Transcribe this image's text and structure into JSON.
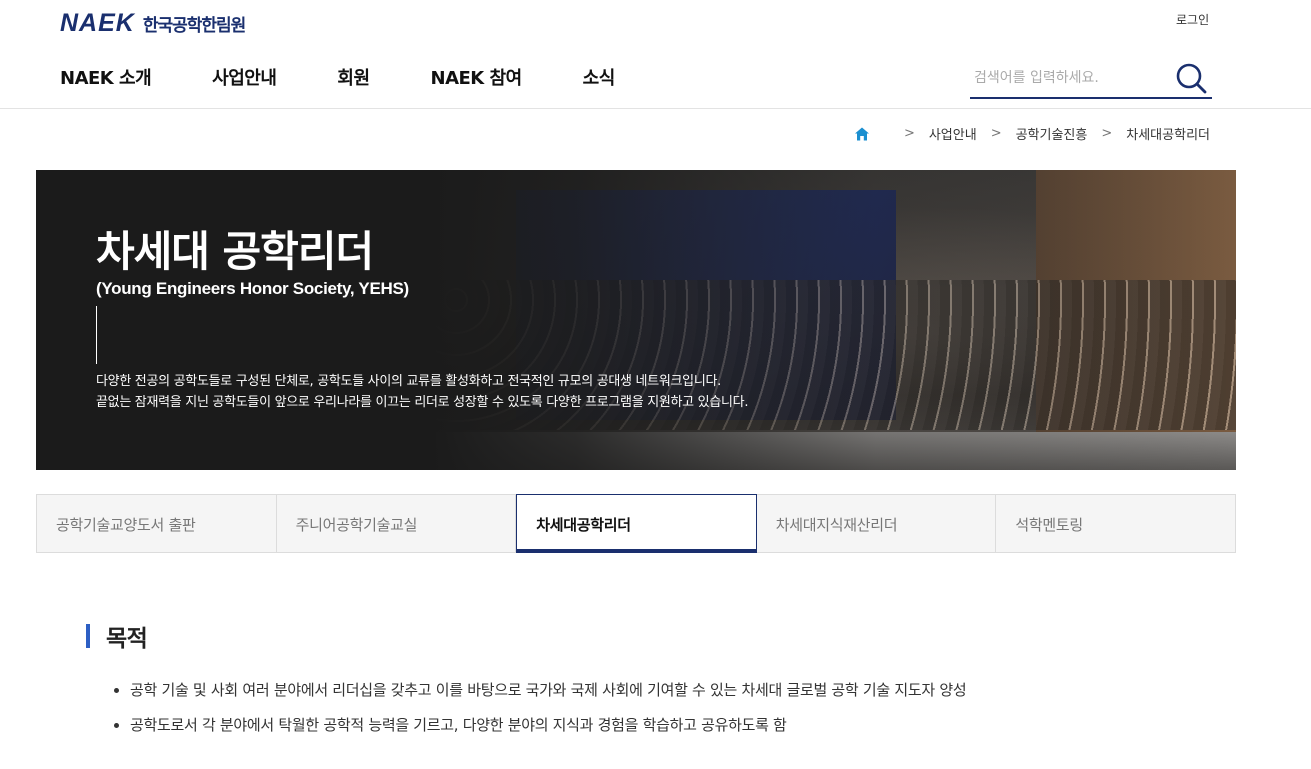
{
  "header": {
    "logo_mark": "NAEK",
    "logo_name": "한국공학한림원",
    "login": "로그인",
    "nav": [
      "NAEK 소개",
      "사업안내",
      "회원",
      "NAEK 참여",
      "소식"
    ],
    "search_placeholder": "검색어를 입력하세요."
  },
  "breadcrumb": {
    "items": [
      "사업안내",
      "공학기술진흥",
      "차세대공학리더"
    ]
  },
  "banner": {
    "title": "차세대 공학리더",
    "subtitle": "(Young Engineers Honor Society, YEHS)",
    "desc_line1": "다양한 전공의 공학도들로 구성된 단체로, 공학도들 사이의 교류를 활성화하고 전국적인 규모의 공대생 네트워크입니다.",
    "desc_line2": "끝없는 잠재력을 지닌 공학도들이 앞으로 우리나라를 이끄는 리더로 성장할 수 있도록 다양한 프로그램을 지원하고 있습니다."
  },
  "tabs": [
    {
      "label": "공학기술교양도서 출판",
      "active": false
    },
    {
      "label": "주니어공학기술교실",
      "active": false
    },
    {
      "label": "차세대공학리더",
      "active": true
    },
    {
      "label": "차세대지식재산리더",
      "active": false
    },
    {
      "label": "석학멘토링",
      "active": false
    }
  ],
  "content": {
    "section_title": "목적",
    "items": [
      "공학 기술 및 사회 여러 분야에서 리더십을 갖추고 이를 바탕으로 국가와 국제 사회에 기여할 수 있는 차세대 글로벌 공학 기술 지도자 양성",
      "공학도로서 각 분야에서 탁월한 공학적 능력을 기르고, 다양한 분야의 지식과 경험을 학습하고 공유하도록 함"
    ]
  },
  "colors": {
    "brand": "#1a2f6e",
    "accent": "#2d5fc4",
    "home_icon": "#1b8fd0"
  }
}
